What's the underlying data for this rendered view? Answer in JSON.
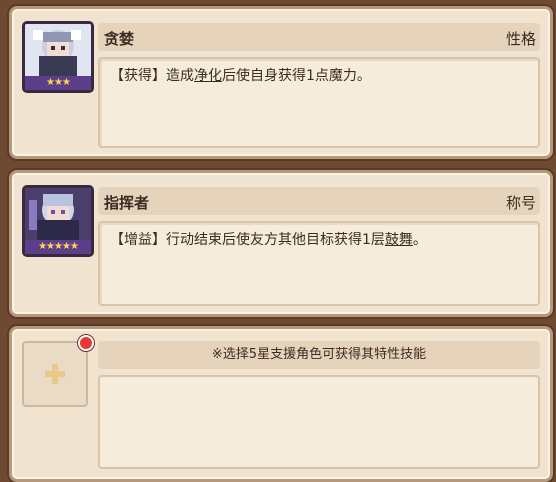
{
  "cards": [
    {
      "name": "贪婪",
      "tag": "性格",
      "stars": "★★★",
      "desc": {
        "prefix": "【获得】造成",
        "keyword": "净化",
        "suffix": "后使自身获得1点魔力。"
      }
    },
    {
      "name": "指挥者",
      "tag": "称号",
      "stars": "★★★★★",
      "desc": {
        "prefix": "【增益】行动结束后使友方其他目标获得1层",
        "keyword": "鼓舞",
        "suffix": "。"
      }
    }
  ],
  "slot": {
    "hint": "※选择5星支援角色可获得其特性技能",
    "icon": "plus-icon",
    "badge": "red-dot-icon"
  },
  "colors": {
    "background": "#6f4a33",
    "card": "#f0e3cf",
    "header": "#e6d3bc",
    "badge": "#e53935"
  }
}
